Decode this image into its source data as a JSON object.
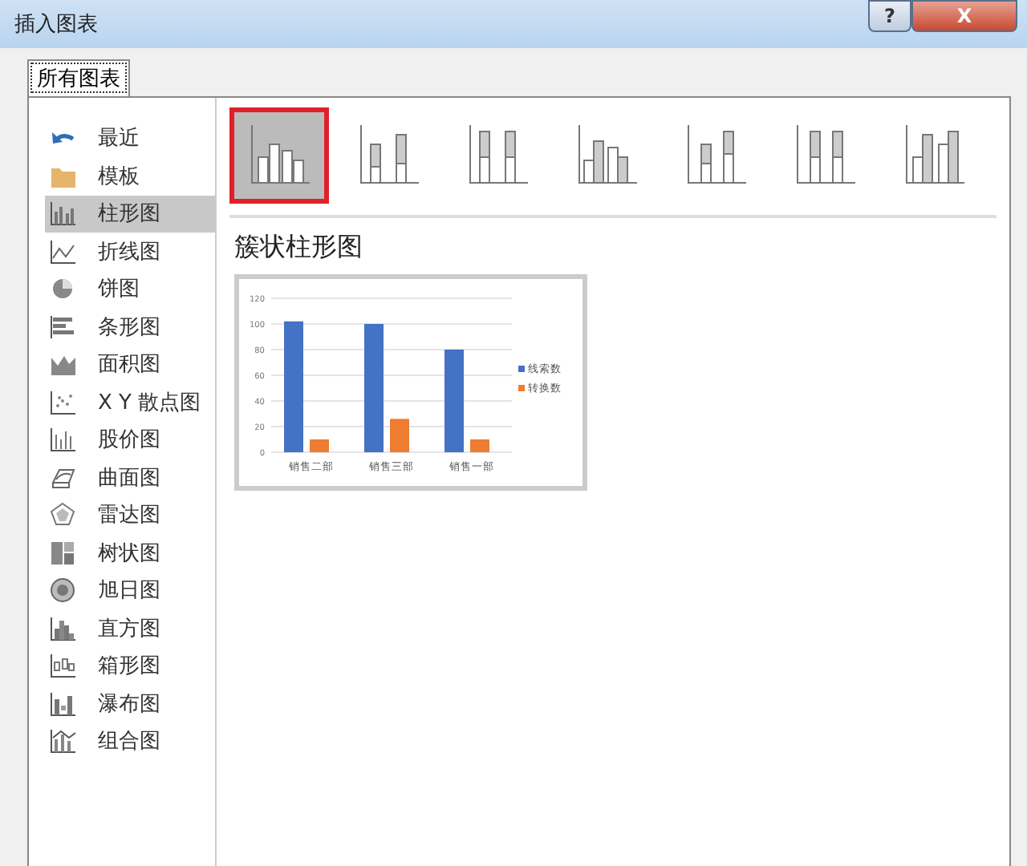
{
  "window": {
    "title": "插入图表",
    "help": "?",
    "close": "X"
  },
  "tabs": [
    {
      "label": "所有图表",
      "selected": true
    }
  ],
  "sidebar": {
    "items": [
      {
        "label": "最近",
        "selected": false
      },
      {
        "label": "模板",
        "selected": false
      },
      {
        "label": "柱形图",
        "selected": true
      },
      {
        "label": "折线图",
        "selected": false
      },
      {
        "label": "饼图",
        "selected": false
      },
      {
        "label": "条形图",
        "selected": false
      },
      {
        "label": "面积图",
        "selected": false
      },
      {
        "label": "X Y 散点图",
        "selected": false
      },
      {
        "label": "股价图",
        "selected": false
      },
      {
        "label": "曲面图",
        "selected": false
      },
      {
        "label": "雷达图",
        "selected": false
      },
      {
        "label": "树状图",
        "selected": false
      },
      {
        "label": "旭日图",
        "selected": false
      },
      {
        "label": "直方图",
        "selected": false
      },
      {
        "label": "箱形图",
        "selected": false
      },
      {
        "label": "瀑布图",
        "selected": false
      },
      {
        "label": "组合图",
        "selected": false
      }
    ]
  },
  "subtypes": [
    {
      "selected": true
    },
    {
      "selected": false
    },
    {
      "selected": false
    },
    {
      "selected": false
    },
    {
      "selected": false
    },
    {
      "selected": false
    },
    {
      "selected": false
    }
  ],
  "preview": {
    "title": "簇状柱形图",
    "chart_data": {
      "type": "bar",
      "categories": [
        "销售二部",
        "销售三部",
        "销售一部"
      ],
      "series": [
        {
          "name": "线索数",
          "color": "#4472c4",
          "values": [
            102,
            100,
            80
          ]
        },
        {
          "name": "转换数",
          "color": "#ed7d31",
          "values": [
            10,
            26,
            10
          ]
        }
      ],
      "grid": true,
      "legend": "right",
      "ylim": [
        0,
        120
      ],
      "yticks": [
        0,
        20,
        40,
        60,
        80,
        100,
        120
      ]
    }
  }
}
